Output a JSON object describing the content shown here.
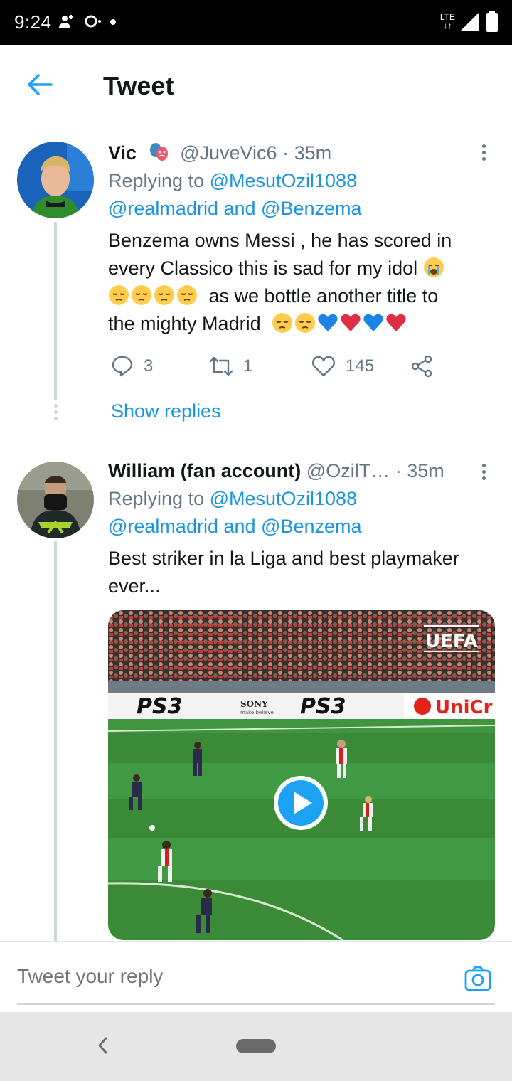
{
  "status_bar": {
    "time": "9:24",
    "network": "LTE"
  },
  "header": {
    "title": "Tweet"
  },
  "tweets": [
    {
      "name": "Vic",
      "handle": "@JuveVic6",
      "separator": " · ",
      "time": "35m",
      "replying_prefix": "Replying to ",
      "reply_mention_1": "@MesutOzil1088",
      "reply_mention_2": "@realmadrid",
      "reply_and": " and ",
      "reply_mention_3": "@Benzema",
      "text_line_1": "Benzema owns Messi , he has scored in",
      "text_line_2": "every Classico this is sad for my idol",
      "text_line_3": "as we bottle another title to",
      "text_line_4": "the mighty Madrid",
      "replies": "3",
      "retweets": "1",
      "likes": "145",
      "show_replies": "Show replies"
    },
    {
      "name": "William (fan account)",
      "handle": "@OzilT…",
      "separator": " · ",
      "time": "35m",
      "replying_prefix": "Replying to ",
      "reply_mention_1": "@MesutOzil1088",
      "reply_mention_2": "@realmadrid",
      "reply_and": " and ",
      "reply_mention_3": "@Benzema",
      "text_line_1": "Best striker in la Liga and best playmaker",
      "text_line_2": "ever...",
      "media": {
        "type": "video",
        "watermark": "UEFA",
        "ad_board": [
          "PS3",
          "SONY",
          "make.believe",
          "PS3",
          "UniCr"
        ]
      }
    }
  ],
  "reply_box": {
    "placeholder": "Tweet your reply"
  },
  "colors": {
    "accent": "#1da1f2",
    "text": "#14171a",
    "secondary": "#657786",
    "divider": "#e1e8ed"
  }
}
